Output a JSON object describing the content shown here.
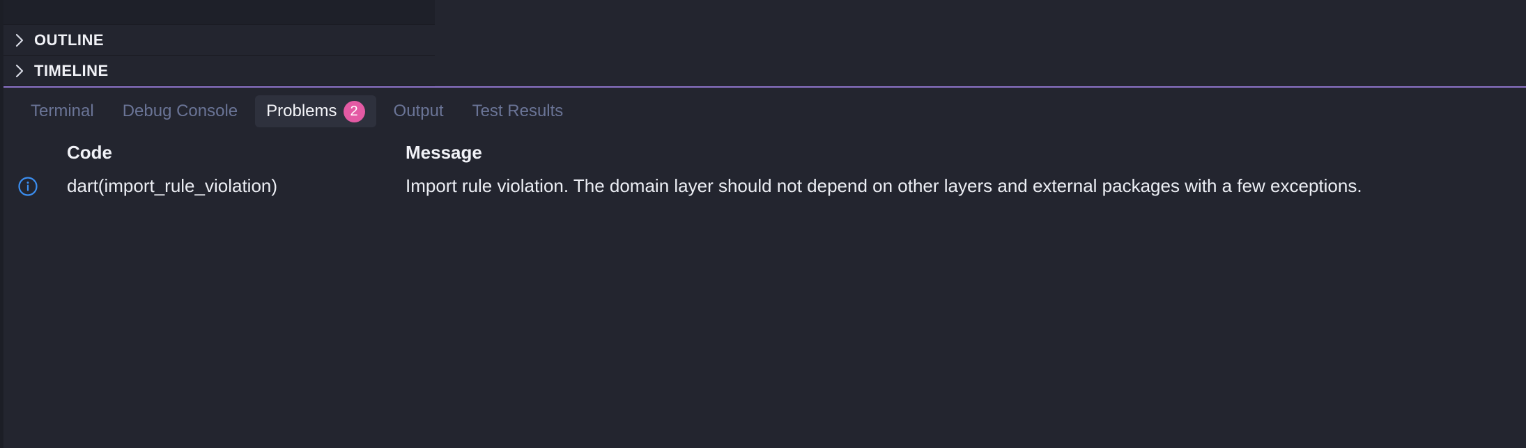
{
  "sidebar": {
    "sections": [
      {
        "label": "OUTLINE",
        "icon": "chevron-right-icon"
      },
      {
        "label": "TIMELINE",
        "icon": "chevron-right-icon"
      }
    ]
  },
  "panel": {
    "accent_color": "#8c73c8",
    "tabs": [
      {
        "label": "Terminal"
      },
      {
        "label": "Debug Console"
      },
      {
        "label": "Problems",
        "badge": "2",
        "active": true
      },
      {
        "label": "Output"
      },
      {
        "label": "Test Results"
      }
    ],
    "badge_color": "#e45aa4"
  },
  "problems": {
    "columns": {
      "code": "Code",
      "message": "Message"
    },
    "rows": [
      {
        "severity_icon": "info-icon",
        "code": "dart(import_rule_violation)",
        "message": "Import rule violation. The domain layer should not depend on other layers and external packages with a few exceptions."
      }
    ]
  }
}
